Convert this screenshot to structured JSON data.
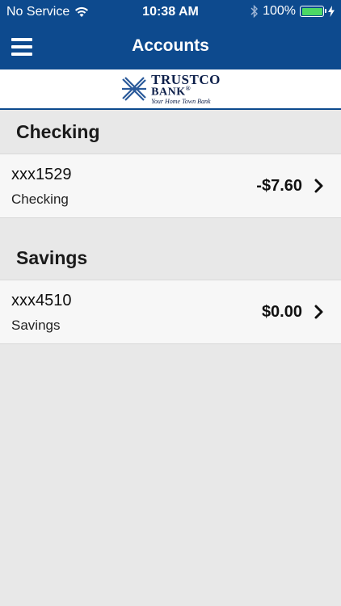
{
  "status_bar": {
    "carrier": "No Service",
    "time": "10:38 AM",
    "battery_percent": "100%",
    "icons": [
      "wifi-icon",
      "bluetooth-icon",
      "battery-icon",
      "charging-icon"
    ],
    "battery_level": 1.0,
    "battery_color": "#4cd964"
  },
  "nav": {
    "title": "Accounts",
    "menu_icon": "hamburger-menu-icon"
  },
  "logo": {
    "name": "TRUSTCO",
    "bank": "BANK",
    "registered": "®",
    "tagline": "Your Home Town Bank"
  },
  "colors": {
    "brand_blue": "#0d4a8e",
    "background": "#e8e8e8",
    "row_background": "#f7f7f7"
  },
  "sections": [
    {
      "title": "Checking",
      "accounts": [
        {
          "number": "xxx1529",
          "type": "Checking",
          "balance": "-$7.60"
        }
      ]
    },
    {
      "title": "Savings",
      "accounts": [
        {
          "number": "xxx4510",
          "type": "Savings",
          "balance": "$0.00"
        }
      ]
    }
  ]
}
